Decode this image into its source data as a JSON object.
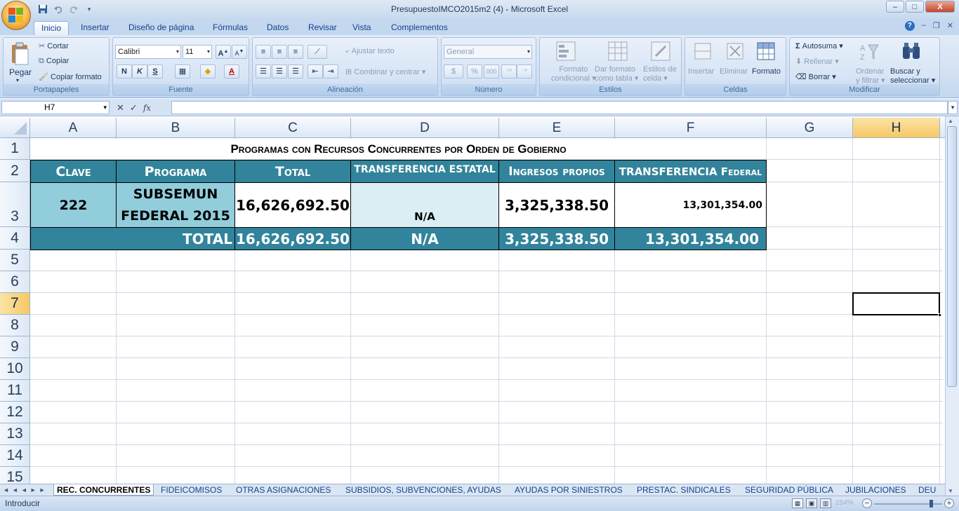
{
  "window": {
    "title": "PresupuestoIMCO2015m2 (4) - Microsoft Excel",
    "controls": [
      "–",
      "□",
      "X"
    ]
  },
  "ribbon_tabs": [
    "Inicio",
    "Insertar",
    "Diseño de página",
    "Fórmulas",
    "Datos",
    "Revisar",
    "Vista",
    "Complementos"
  ],
  "ribbon": {
    "portapapeles": {
      "label": "Portapapeles",
      "pegar": "Pegar",
      "cortar": "Cortar",
      "copiar": "Copiar",
      "copiar_formato": "Copiar formato"
    },
    "fuente": {
      "label": "Fuente",
      "font": "Calibri",
      "size": "11",
      "bold": "N",
      "italic": "K",
      "underline": "S"
    },
    "alineacion": {
      "label": "Alineación",
      "ajustar": "Ajustar texto",
      "combinar": "Combinar y centrar"
    },
    "numero": {
      "label": "Número",
      "format": "General",
      "currency": "$",
      "percent": "%",
      "thousands": "000"
    },
    "estilos": {
      "label": "Estilos",
      "formato_cond_1": "Formato",
      "formato_cond_2": "condicional",
      "dar_formato_1": "Dar formato",
      "dar_formato_2": "como tabla",
      "estilos_celda_1": "Estilos de",
      "estilos_celda_2": "celda"
    },
    "celdas": {
      "label": "Celdas",
      "insertar": "Insertar",
      "eliminar": "Eliminar",
      "formato": "Formato"
    },
    "modificar": {
      "label": "Modificar",
      "autosuma": "Autosuma",
      "rellenar": "Rellenar",
      "borrar": "Borrar",
      "ordenar_1": "Ordenar",
      "ordenar_2": "y filtrar",
      "buscar_1": "Buscar y",
      "buscar_2": "seleccionar"
    }
  },
  "formula_bar": {
    "name_box": "H7",
    "fx": "fx",
    "content": ""
  },
  "columns": [
    "A",
    "B",
    "C",
    "D",
    "E",
    "F",
    "G",
    "H"
  ],
  "rows": [
    "1",
    "2",
    "3",
    "4",
    "5",
    "6",
    "7",
    "8",
    "9",
    "10",
    "11",
    "12",
    "13",
    "14",
    "15"
  ],
  "sheet": {
    "title": "Programas con Recursos Concurrentes por Orden de Gobierno",
    "headers": [
      "Clave",
      "Programa",
      "Total",
      "TRANSFERENCIA ESTATAL",
      "Ingresos propios",
      "TRANSFERENCIA Federal"
    ],
    "row3": {
      "clave": "222",
      "programa_1": "SUBSEMUN",
      "programa_2": "FEDERAL 2015",
      "total": "16,626,692.50",
      "estatal": "N/A",
      "propios": "3,325,338.50",
      "federal": "13,301,354.00"
    },
    "row4": {
      "label": "TOTAL",
      "total": "16,626,692.50",
      "estatal": "N/A",
      "propios": "3,325,338.50",
      "federal": "13,301,354.00"
    }
  },
  "sheet_tabs": [
    "REC. CONCURRENTES",
    "FIDEICOMISOS",
    "OTRAS ASIGNACIONES",
    "SUBSIDIOS, SUBVENCIONES, AYUDAS",
    "AYUDAS POR SINIESTROS",
    "PRESTAC. SINDICALES",
    "SEGURIDAD PÚBLICA",
    "JUBILACIONES",
    "DEU"
  ],
  "status": {
    "mode": "Introducir",
    "zoom": "154%"
  },
  "colors": {
    "header_fill": "#31849b",
    "data_fill": "#dbeef4",
    "selected_header": "#f7c865"
  }
}
